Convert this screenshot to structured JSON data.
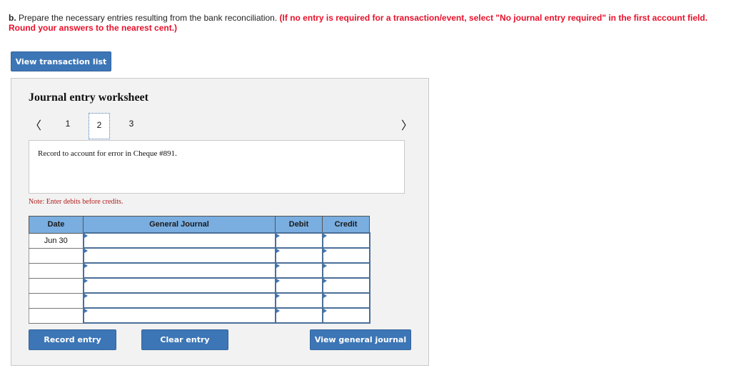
{
  "instructions": {
    "lead": "b.",
    "text": " Prepare the necessary entries resulting from the bank reconciliation. ",
    "emphasis": "(If no entry is required for a transaction/event, select \"No journal entry required\" in the first account field. Round your answers to the nearest cent.)"
  },
  "view_transaction_list_label": "View transaction list",
  "worksheet": {
    "title": "Journal entry worksheet",
    "tabs": [
      {
        "label": "1",
        "active": false
      },
      {
        "label": "2",
        "active": true
      },
      {
        "label": "3",
        "active": false
      }
    ],
    "prev_icon": "chevron-left-icon",
    "next_icon": "chevron-right-icon",
    "description": "Record to account for error in Cheque #891.",
    "note": "Note: Enter debits before credits.",
    "table": {
      "headers": [
        "Date",
        "General Journal",
        "Debit",
        "Credit"
      ],
      "rows": [
        {
          "date": "Jun 30",
          "account": "",
          "debit": "",
          "credit": ""
        },
        {
          "date": "",
          "account": "",
          "debit": "",
          "credit": ""
        },
        {
          "date": "",
          "account": "",
          "debit": "",
          "credit": ""
        },
        {
          "date": "",
          "account": "",
          "debit": "",
          "credit": ""
        },
        {
          "date": "",
          "account": "",
          "debit": "",
          "credit": ""
        },
        {
          "date": "",
          "account": "",
          "debit": "",
          "credit": ""
        }
      ]
    },
    "buttons": {
      "record": "Record entry",
      "clear": "Clear entry",
      "view_general_journal": "View general journal"
    }
  },
  "colors": {
    "accent_blue": "#3d76b6",
    "header_blue": "#7aaee0",
    "instruction_red": "#e8102a",
    "note_red": "#b01c1c"
  }
}
